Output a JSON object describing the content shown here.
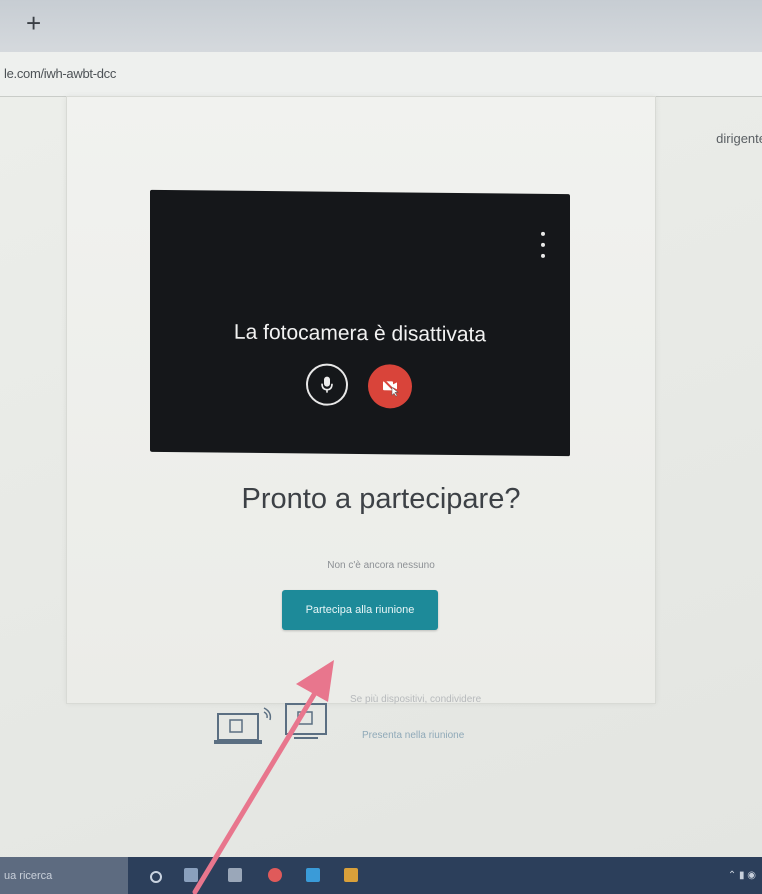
{
  "browser": {
    "new_tab_label": "+",
    "url": "le.com/iwh-awbt-dcc"
  },
  "header": {
    "account": "dirigente"
  },
  "preview": {
    "message": "La fotocamera è disattivata",
    "more_icon": "more-vert-icon",
    "mic_icon": "microphone-icon",
    "camera_icon": "camera-off-icon"
  },
  "join": {
    "title": "Pronto a partecipare?",
    "subtitle": "Non c'è ancora nessuno",
    "button_label": "Partecipa alla riunione"
  },
  "present": {
    "other_text": "Se più dispositivi, condividere",
    "link_label": "Presenta nella riunione",
    "devices_icon": "cast-devices-icon"
  },
  "taskbar": {
    "search_placeholder": "ua ricerca"
  },
  "colors": {
    "accent": "#1d8a99",
    "camera_off": "#d9443a",
    "arrow": "#e8768d"
  }
}
